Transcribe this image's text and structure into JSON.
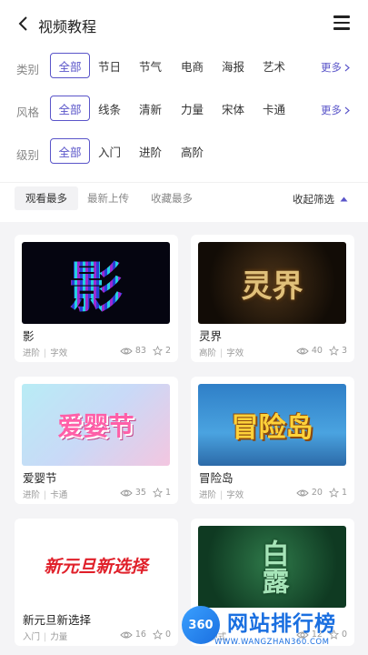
{
  "header": {
    "title": "视频教程",
    "back_icon": "chevron-left-icon",
    "menu_icon": "menu-icon"
  },
  "filters": {
    "category": {
      "label": "类别",
      "items": [
        "全部",
        "节日",
        "节气",
        "电商",
        "海报",
        "艺术"
      ],
      "more": "更多"
    },
    "style": {
      "label": "风格",
      "items": [
        "全部",
        "线条",
        "清新",
        "力量",
        "宋体",
        "卡通"
      ],
      "more": "更多"
    },
    "level": {
      "label": "级别",
      "items": [
        "全部",
        "入门",
        "进阶",
        "高阶"
      ]
    }
  },
  "sort": {
    "tabs": [
      "观看最多",
      "最新上传",
      "收藏最多"
    ],
    "collapse": "收起筛选"
  },
  "cards": [
    {
      "title": "影",
      "level": "进阶",
      "tag": "字效",
      "views": "83",
      "stars": "2",
      "thumb_text": "影"
    },
    {
      "title": "灵界",
      "level": "高阶",
      "tag": "字效",
      "views": "40",
      "stars": "3",
      "thumb_text": "灵界"
    },
    {
      "title": "爱婴节",
      "level": "进阶",
      "tag": "卡通",
      "views": "35",
      "stars": "1",
      "thumb_text": "爱婴节"
    },
    {
      "title": "冒险岛",
      "level": "进阶",
      "tag": "字效",
      "views": "20",
      "stars": "1",
      "thumb_text": "冒险岛"
    },
    {
      "title": "新元旦新选择",
      "level": "入门",
      "tag": "力量",
      "views": "16",
      "stars": "0",
      "thumb_text": "新元旦新选择"
    },
    {
      "title": "",
      "level": "",
      "tag": "中式",
      "views": "12",
      "stars": "0",
      "thumb_text": "白露"
    }
  ],
  "watermark": {
    "logo": "360",
    "text": "网站排行榜",
    "url": "WWW.WANGZHAN360.COM"
  },
  "colors": {
    "accent": "#5a55c9",
    "watermark": "#1a6fe0"
  }
}
